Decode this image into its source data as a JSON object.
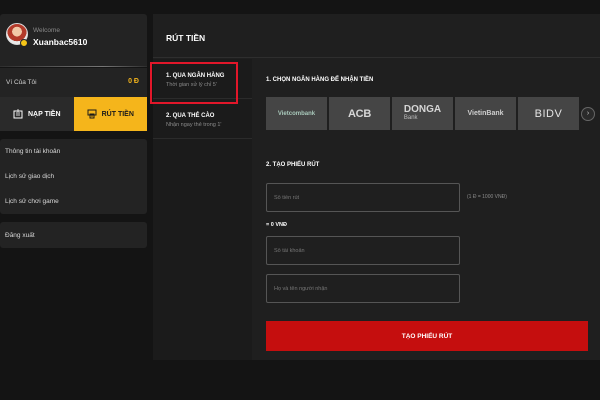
{
  "user": {
    "welcome": "Welcome",
    "username": "Xuanbac5610"
  },
  "wallet": {
    "label": "Ví Của Tôi",
    "value": "0 Đ"
  },
  "actions": {
    "deposit": "NẠP TIỀN",
    "withdraw": "RÚT TIỀN"
  },
  "menu": {
    "items": [
      "Thông tin tài khoản",
      "Lịch sử giao dịch",
      "Lịch sử chơi game"
    ],
    "logout": "Đăng xuất"
  },
  "main": {
    "title": "RÚT TIỀN",
    "tabs": [
      {
        "title": "1. QUA NGÂN HÀNG",
        "sub": "Thời gian xử lý chỉ 5'"
      },
      {
        "title": "2. QUA THẺ CÀO",
        "sub": "Nhận ngay thẻ trong 1'"
      }
    ],
    "section1": "1. CHỌN NGÂN HÀNG ĐỂ NHẬN TIỀN",
    "banks": [
      "Vietcombank",
      "ACB",
      "DONGA",
      "Bank",
      "VietinBank",
      "BIDV"
    ],
    "section2": "2. TẠO PHIẾU RÚT",
    "amount_placeholder": "Số tiền rút",
    "rate_note": "(1 Đ = 1000 VNĐ)",
    "amount_equals": "= 0 VNĐ",
    "account_placeholder": "Số tài khoản",
    "name_placeholder": "Họ và tên người nhận",
    "submit": "TẠO PHIẾU RÚT"
  },
  "colors": {
    "accent_yellow": "#f5b51b",
    "submit_red": "#c50e0e",
    "highlight_red": "#e2172a"
  }
}
